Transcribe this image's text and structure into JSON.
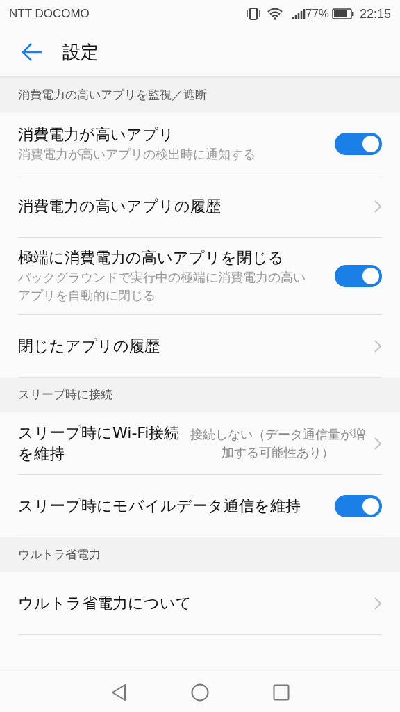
{
  "status_bar": {
    "carrier": "NTT DOCOMO",
    "battery": "77%",
    "time": "22:15"
  },
  "header": {
    "title": "設定"
  },
  "sections": [
    {
      "title": "消費電力の高いアプリを監視／遮断",
      "items": [
        {
          "kind": "toggle",
          "title": "消費電力が高いアプリ",
          "subtitle": "消費電力が高いアプリの検出時に通知する",
          "on": true
        },
        {
          "kind": "link",
          "title": "消費電力の高いアプリの履歴"
        },
        {
          "kind": "toggle",
          "title": "極端に消費電力の高いアプリを閉じる",
          "subtitle": "バックグラウンドで実行中の極端に消費電力の高いアプリを自動的に閉じる",
          "on": true
        },
        {
          "kind": "link",
          "title": "閉じたアプリの履歴"
        }
      ]
    },
    {
      "title": "スリープ時に接続",
      "items": [
        {
          "kind": "value",
          "title": "スリープ時にWi-Fi接続を維持",
          "value": "接続しない（データ通信量が増加する可能性あり）"
        },
        {
          "kind": "toggle",
          "title": "スリープ時にモバイルデータ通信を維持",
          "on": true
        }
      ]
    },
    {
      "title": "ウルトラ省電力",
      "items": [
        {
          "kind": "link",
          "title": "ウルトラ省電力について"
        }
      ]
    }
  ]
}
